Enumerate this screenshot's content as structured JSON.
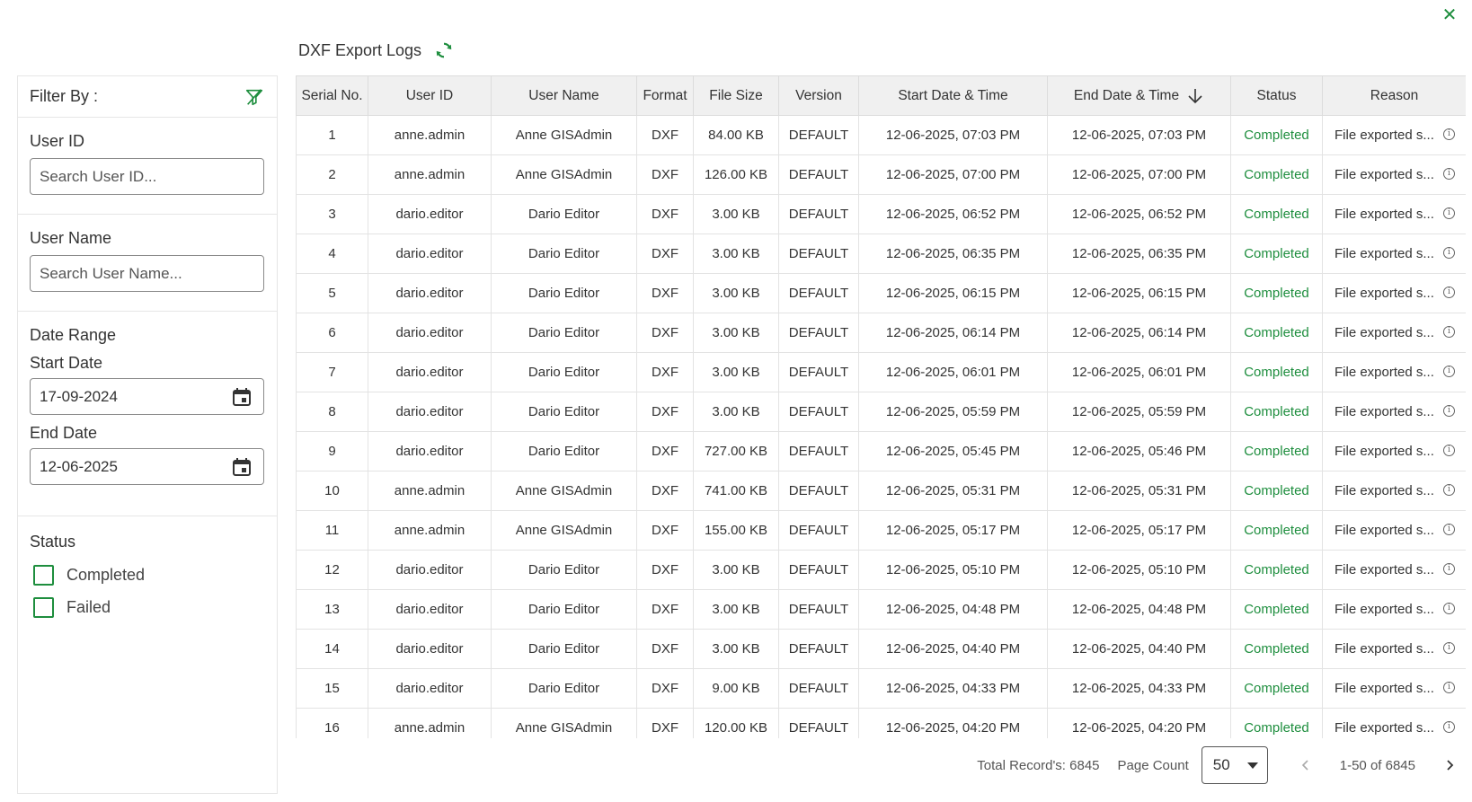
{
  "header": {
    "title": "DXF Export Logs"
  },
  "filter": {
    "title": "Filter By :",
    "user_id": {
      "label": "User ID",
      "placeholder": "Search User ID..."
    },
    "user_name": {
      "label": "User Name",
      "placeholder": "Search User Name..."
    },
    "date_range": {
      "label": "Date Range",
      "start_label": "Start Date",
      "start_value": "17-09-2024",
      "end_label": "End Date",
      "end_value": "12-06-2025"
    },
    "status": {
      "label": "Status",
      "options": [
        "Completed",
        "Failed"
      ]
    }
  },
  "table": {
    "columns": [
      "Serial No.",
      "User ID",
      "User Name",
      "Format",
      "File Size",
      "Version",
      "Start Date & Time",
      "End Date & Time",
      "Status",
      "Reason"
    ],
    "sorted_column": "End Date & Time",
    "rows": [
      [
        "1",
        "anne.admin",
        "Anne GISAdmin",
        "DXF",
        "84.00 KB",
        "DEFAULT",
        "12-06-2025, 07:03 PM",
        "12-06-2025, 07:03 PM",
        "Completed",
        "File exported s..."
      ],
      [
        "2",
        "anne.admin",
        "Anne GISAdmin",
        "DXF",
        "126.00 KB",
        "DEFAULT",
        "12-06-2025, 07:00 PM",
        "12-06-2025, 07:00 PM",
        "Completed",
        "File exported s..."
      ],
      [
        "3",
        "dario.editor",
        "Dario Editor",
        "DXF",
        "3.00 KB",
        "DEFAULT",
        "12-06-2025, 06:52 PM",
        "12-06-2025, 06:52 PM",
        "Completed",
        "File exported s..."
      ],
      [
        "4",
        "dario.editor",
        "Dario Editor",
        "DXF",
        "3.00 KB",
        "DEFAULT",
        "12-06-2025, 06:35 PM",
        "12-06-2025, 06:35 PM",
        "Completed",
        "File exported s..."
      ],
      [
        "5",
        "dario.editor",
        "Dario Editor",
        "DXF",
        "3.00 KB",
        "DEFAULT",
        "12-06-2025, 06:15 PM",
        "12-06-2025, 06:15 PM",
        "Completed",
        "File exported s..."
      ],
      [
        "6",
        "dario.editor",
        "Dario Editor",
        "DXF",
        "3.00 KB",
        "DEFAULT",
        "12-06-2025, 06:14 PM",
        "12-06-2025, 06:14 PM",
        "Completed",
        "File exported s..."
      ],
      [
        "7",
        "dario.editor",
        "Dario Editor",
        "DXF",
        "3.00 KB",
        "DEFAULT",
        "12-06-2025, 06:01 PM",
        "12-06-2025, 06:01 PM",
        "Completed",
        "File exported s..."
      ],
      [
        "8",
        "dario.editor",
        "Dario Editor",
        "DXF",
        "3.00 KB",
        "DEFAULT",
        "12-06-2025, 05:59 PM",
        "12-06-2025, 05:59 PM",
        "Completed",
        "File exported s..."
      ],
      [
        "9",
        "dario.editor",
        "Dario Editor",
        "DXF",
        "727.00 KB",
        "DEFAULT",
        "12-06-2025, 05:45 PM",
        "12-06-2025, 05:46 PM",
        "Completed",
        "File exported s..."
      ],
      [
        "10",
        "anne.admin",
        "Anne GISAdmin",
        "DXF",
        "741.00 KB",
        "DEFAULT",
        "12-06-2025, 05:31 PM",
        "12-06-2025, 05:31 PM",
        "Completed",
        "File exported s..."
      ],
      [
        "11",
        "anne.admin",
        "Anne GISAdmin",
        "DXF",
        "155.00 KB",
        "DEFAULT",
        "12-06-2025, 05:17 PM",
        "12-06-2025, 05:17 PM",
        "Completed",
        "File exported s..."
      ],
      [
        "12",
        "dario.editor",
        "Dario Editor",
        "DXF",
        "3.00 KB",
        "DEFAULT",
        "12-06-2025, 05:10 PM",
        "12-06-2025, 05:10 PM",
        "Completed",
        "File exported s..."
      ],
      [
        "13",
        "dario.editor",
        "Dario Editor",
        "DXF",
        "3.00 KB",
        "DEFAULT",
        "12-06-2025, 04:48 PM",
        "12-06-2025, 04:48 PM",
        "Completed",
        "File exported s..."
      ],
      [
        "14",
        "dario.editor",
        "Dario Editor",
        "DXF",
        "3.00 KB",
        "DEFAULT",
        "12-06-2025, 04:40 PM",
        "12-06-2025, 04:40 PM",
        "Completed",
        "File exported s..."
      ],
      [
        "15",
        "dario.editor",
        "Dario Editor",
        "DXF",
        "9.00 KB",
        "DEFAULT",
        "12-06-2025, 04:33 PM",
        "12-06-2025, 04:33 PM",
        "Completed",
        "File exported s..."
      ],
      [
        "16",
        "anne.admin",
        "Anne GISAdmin",
        "DXF",
        "120.00 KB",
        "DEFAULT",
        "12-06-2025, 04:20 PM",
        "12-06-2025, 04:20 PM",
        "Completed",
        "File exported s..."
      ]
    ]
  },
  "footer": {
    "total": "Total Record's: 6845",
    "page_count_label": "Page Count",
    "page_size": "50",
    "range": "1-50 of 6845"
  },
  "colors": {
    "accent": "#1e8e3e",
    "header_bg": "#f0f0f0"
  },
  "icons": [
    "close-icon",
    "refresh-icon",
    "clear-filter-icon",
    "calendar-icon",
    "sort-down-icon",
    "info-icon",
    "chevron-left-icon",
    "chevron-right-icon",
    "caret-down-icon"
  ]
}
